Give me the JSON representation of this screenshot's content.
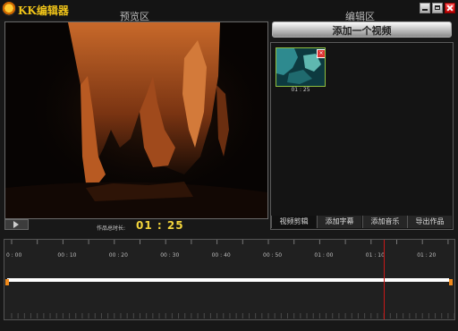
{
  "window": {
    "title": "KK编辑器"
  },
  "sections": {
    "preview": "预览区",
    "edit": "编辑区"
  },
  "preview": {
    "total_label": "作品总时长:",
    "total_value": "01 : 25"
  },
  "edit": {
    "add_video": "添加一个视频",
    "clips": [
      {
        "duration": "01 : 25",
        "delete_glyph": "×"
      }
    ],
    "tabs": [
      "视频剪辑",
      "添加字幕",
      "添加音乐",
      "导出作品"
    ]
  },
  "timeline": {
    "ticks": [
      "0 : 00",
      "00 : 10",
      "00 : 20",
      "00 : 30",
      "00 : 40",
      "00 : 50",
      "01 : 00",
      "01 : 10",
      "01 : 20"
    ],
    "playhead_position": "01 : 14"
  },
  "colors": {
    "accent": "#f3d53c",
    "playhead": "#c81818",
    "handle": "#f08a1c",
    "clip_border": "#8fbf3f"
  }
}
